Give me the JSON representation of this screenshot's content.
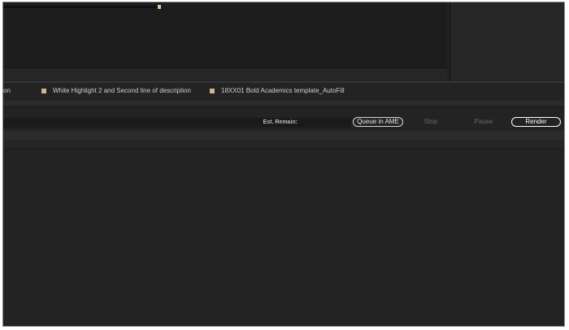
{
  "tracks": [
    {
      "label": "on",
      "color": ""
    },
    {
      "label": "White Highlight 2 and Second line of description",
      "color": "#cbb594"
    },
    {
      "label": "18XX01 Bold Academics template_AutoFill",
      "color": "#cbb594"
    }
  ],
  "render": {
    "est_remain_label": "Est. Remain:",
    "queue_label": "Queue in AME",
    "stop_label": "Stop",
    "pause_label": "Pause",
    "render_label": "Render"
  }
}
